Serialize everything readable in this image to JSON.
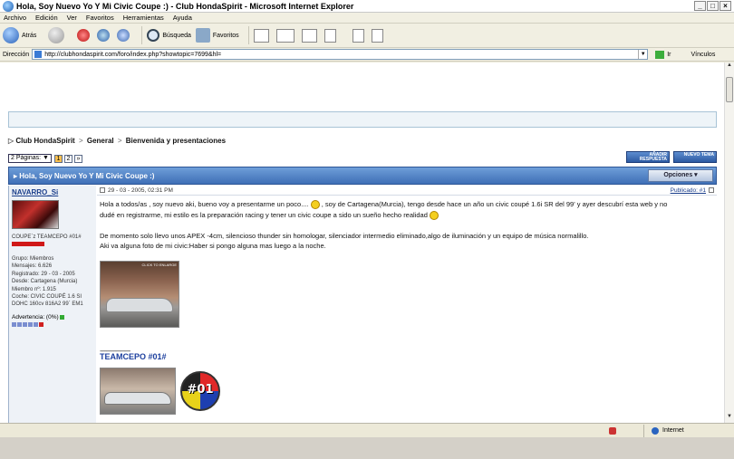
{
  "window": {
    "title": "Hola, Soy Nuevo Yo Y Mi Civic Coupe :) - Club HondaSpirit - Microsoft Internet Explorer",
    "controls": [
      "_",
      "□",
      "×"
    ]
  },
  "menu": [
    "Archivo",
    "Edición",
    "Ver",
    "Favoritos",
    "Herramientas",
    "Ayuda"
  ],
  "toolbar": {
    "back": "Atrás",
    "search": "Búsqueda",
    "favorites": "Favoritos"
  },
  "address": {
    "label": "Dirección",
    "url": "http://clubhondaspirit.com/foro/index.php?showtopic=7699&hl=",
    "go": "Ir",
    "links": "Vínculos"
  },
  "breadcrumb": [
    "Club HondaSpirit",
    "General",
    "Bienvenida y presentaciones"
  ],
  "pager": {
    "select_label": "2 Páginas: ▼",
    "pages": [
      "1",
      "2",
      "»"
    ]
  },
  "actions": {
    "reply": "AÑADIR RESPUESTA",
    "new_topic": "NUEVO TEMA"
  },
  "topic": {
    "title": "Hola, Soy Nuevo Yo Y Mi Civic Coupe :)",
    "options": "Opciones ▾"
  },
  "post": {
    "author": "NAVARRO_Si",
    "user_title": "COUPE`z TEAMCEPO #01#",
    "stats": [
      "Grupo: Miembros",
      "Mensajes: 6.626",
      "Registrado: 29 - 03 - 2005",
      "Desde: Cartagena (Murcia)",
      "Miembro nº: 1.915",
      "Coche: CIVIC COUPÉ 1.6 SI",
      "DOHC 160cv 816A2 99´ EM1"
    ],
    "warning_label": "Advertencia: (0%)",
    "date": "29 - 03 - 2005, 02:31 PM",
    "published": "Publicado: #1",
    "line1a": "Hola a todos/as , soy nuevo aki, bueno voy a presentarme un poco.... ",
    "line1b": " , soy de Cartagena(Murcia), tengo desde hace un año un civic coupé 1.6i SR del 99' y ayer descubrí esta web y no",
    "line2": "dudé en registrarme, mi estilo es la preparación racing y tener un civic coupe a sido un sueño hecho realidad ",
    "line3": "De momento solo llevo unos APEX -4cm, silencioso thunder sin homologar, silenciador intermedio eliminado,algo de iluminación y un equipo de música normalillo.",
    "line4": "Aki va alguna foto de mi civic:Haber si pongo alguna mas luego a la noche.",
    "photo_caption": "CLICK TO ENLARGE",
    "sig_line": "--------------------",
    "sig_team": "TEAMCEPO #01#",
    "logo_text": "#01"
  },
  "status": {
    "zone": "Internet"
  }
}
